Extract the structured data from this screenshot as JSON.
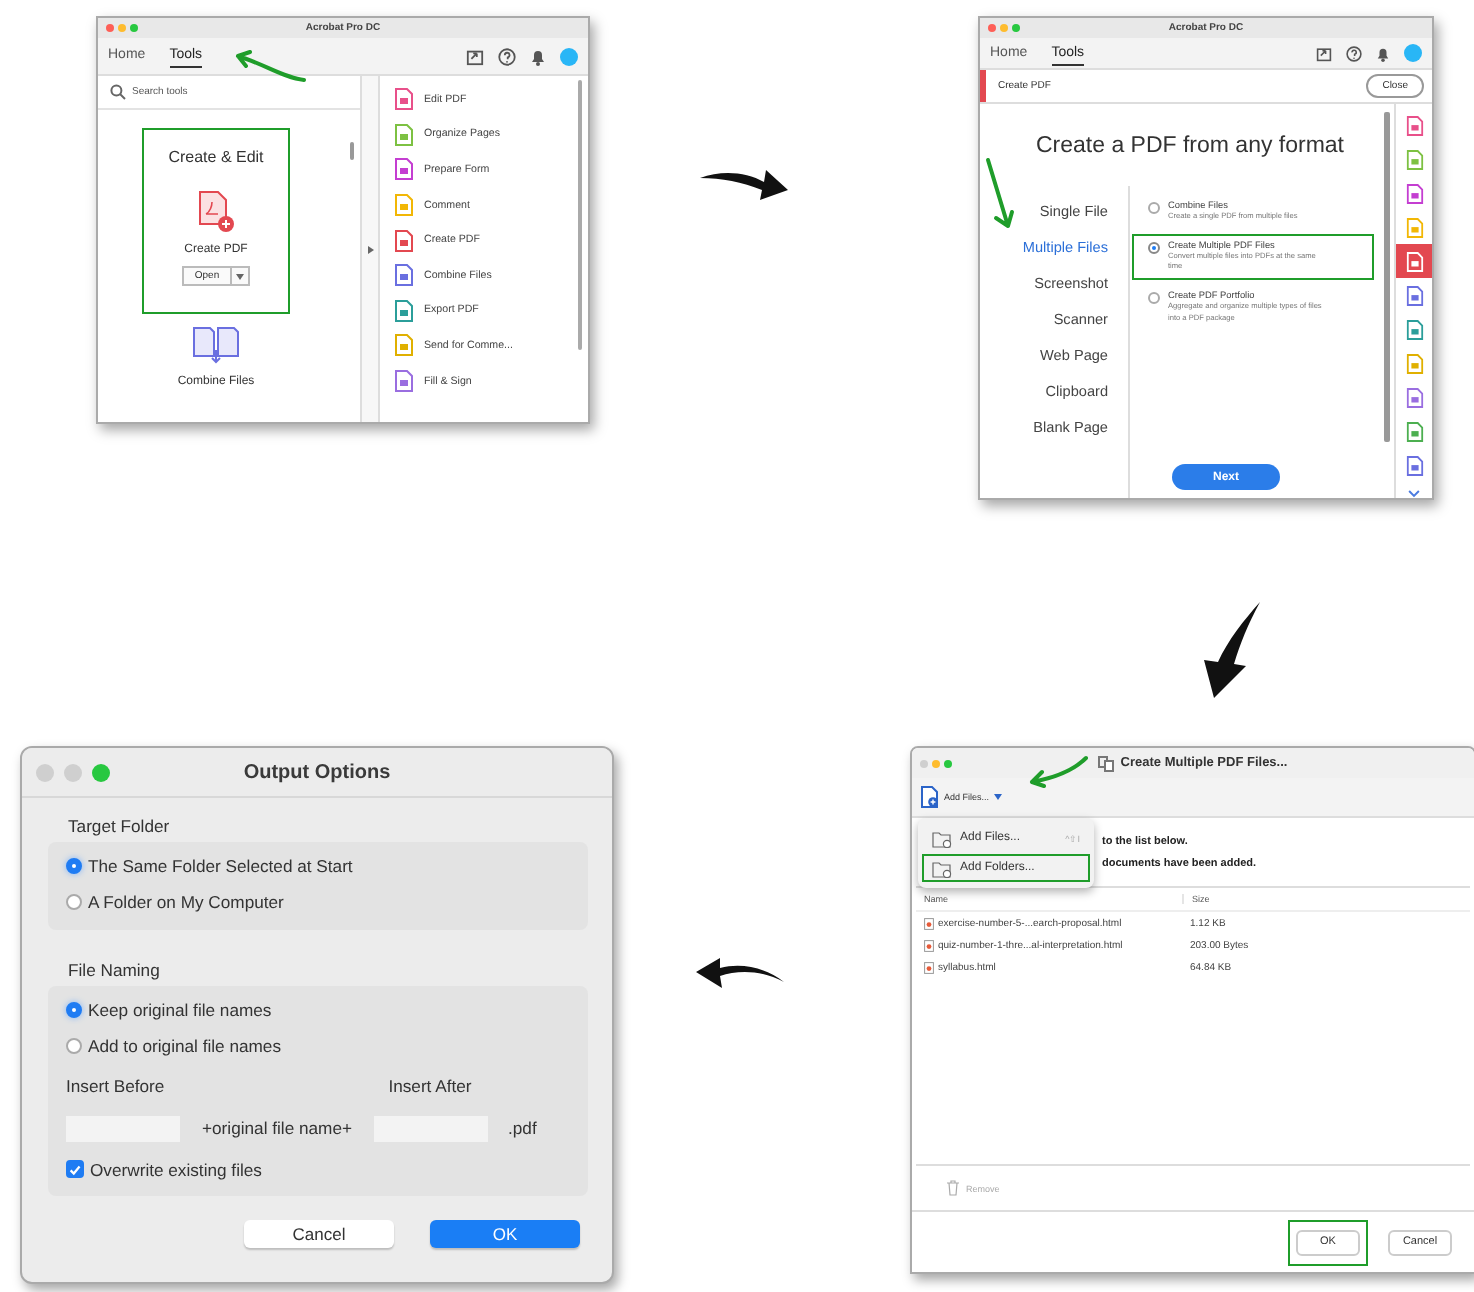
{
  "tools_window": {
    "title": "Acrobat Pro DC",
    "tabs": [
      {
        "label": "Home",
        "selected": false
      },
      {
        "label": "Tools",
        "selected": true
      }
    ],
    "search": {
      "placeholder": "Search tools"
    },
    "featured_card": {
      "heading": "Create & Edit",
      "highlighted": true,
      "tool": "Create PDF",
      "open_button": "Open"
    },
    "next_tool": "Combine Files",
    "tool_list": [
      {
        "label": "Edit PDF",
        "color": "#e8508a"
      },
      {
        "label": "Organize Pages",
        "color": "#7dc142"
      },
      {
        "label": "Prepare Form",
        "color": "#c43ed1"
      },
      {
        "label": "Comment",
        "color": "#f2b705"
      },
      {
        "label": "Create PDF",
        "color": "#e34850"
      },
      {
        "label": "Combine Files",
        "color": "#6a6fe0"
      },
      {
        "label": "Export PDF",
        "color": "#2b9e9a"
      },
      {
        "label": "Send for Comme...",
        "color": "#e0b000"
      },
      {
        "label": "Fill & Sign",
        "color": "#9a6ee0"
      }
    ]
  },
  "create_pdf_window": {
    "title": "Acrobat Pro DC",
    "tabs": [
      {
        "label": "Home",
        "selected": false
      },
      {
        "label": "Tools",
        "selected": true
      }
    ],
    "toolbar_label": "Create PDF",
    "close_button": "Close",
    "heading": "Create a PDF from any format",
    "sources": [
      {
        "label": "Single File",
        "selected": false
      },
      {
        "label": "Multiple Files",
        "selected": true
      },
      {
        "label": "Screenshot",
        "selected": false
      },
      {
        "label": "Scanner",
        "selected": false
      },
      {
        "label": "Web Page",
        "selected": false
      },
      {
        "label": "Clipboard",
        "selected": false
      },
      {
        "label": "Blank Page",
        "selected": false
      }
    ],
    "options": [
      {
        "title": "Combine Files",
        "description": "Create a single PDF from multiple files",
        "selected": false,
        "highlighted": false
      },
      {
        "title": "Create Multiple PDF Files",
        "description": "Convert multiple files into PDFs at the same time",
        "selected": true,
        "highlighted": true
      },
      {
        "title": "Create PDF Portfolio",
        "description": "Aggregate and organize multiple types of files into a PDF package",
        "selected": false,
        "highlighted": false
      }
    ],
    "next_button": "Next",
    "tool_rail": [
      {
        "color": "#e8508a",
        "selected": false
      },
      {
        "color": "#7dc142",
        "selected": false
      },
      {
        "color": "#c43ed1",
        "selected": false
      },
      {
        "color": "#f2b705",
        "selected": false
      },
      {
        "color": "#e34850",
        "selected": true
      },
      {
        "color": "#6a6fe0",
        "selected": false
      },
      {
        "color": "#2b9e9a",
        "selected": false
      },
      {
        "color": "#e0b000",
        "selected": false
      },
      {
        "color": "#9a6ee0",
        "selected": false
      },
      {
        "color": "#4caf50",
        "selected": false
      },
      {
        "color": "#6a6fe0",
        "selected": false
      }
    ]
  },
  "multiple_files_dialog": {
    "title": "Create Multiple PDF Files...",
    "add_files_button": "Add Files...",
    "menu": [
      {
        "label": "Add Files...",
        "shortcut": "^⇧I",
        "highlighted": false
      },
      {
        "label": "Add Folders...",
        "highlighted": true
      }
    ],
    "instructions": [
      "to the list below.",
      "documents have been added."
    ],
    "columns": [
      "Name",
      "Size"
    ],
    "rows": [
      {
        "name": "exercise-number-5-...earch-proposal.html",
        "size": "1.12 KB"
      },
      {
        "name": "quiz-number-1-thre...al-interpretation.html",
        "size": "203.00 Bytes"
      },
      {
        "name": "syllabus.html",
        "size": "64.84 KB"
      }
    ],
    "remove_button": {
      "label": "Remove",
      "disabled": true
    },
    "buttons": [
      {
        "label": "OK",
        "highlighted": true
      },
      {
        "label": "Cancel",
        "highlighted": false
      }
    ]
  },
  "output_options_dialog": {
    "title": "Output Options",
    "target_folder": {
      "label": "Target Folder",
      "options": [
        {
          "label": "The Same Folder Selected at Start",
          "selected": true
        },
        {
          "label": "A Folder on My Computer",
          "selected": false
        }
      ]
    },
    "file_naming": {
      "label": "File Naming",
      "options": [
        {
          "label": "Keep original file names",
          "selected": true
        },
        {
          "label": "Add to original file names",
          "selected": false
        }
      ],
      "insert_before": "Insert Before",
      "insert_after": "Insert After",
      "middle_text": "+original file name+",
      "extension": ".pdf",
      "overwrite": {
        "label": "Overwrite existing files",
        "checked": true
      }
    },
    "buttons": [
      {
        "label": "Cancel",
        "primary": false
      },
      {
        "label": "OK",
        "primary": true
      }
    ]
  }
}
